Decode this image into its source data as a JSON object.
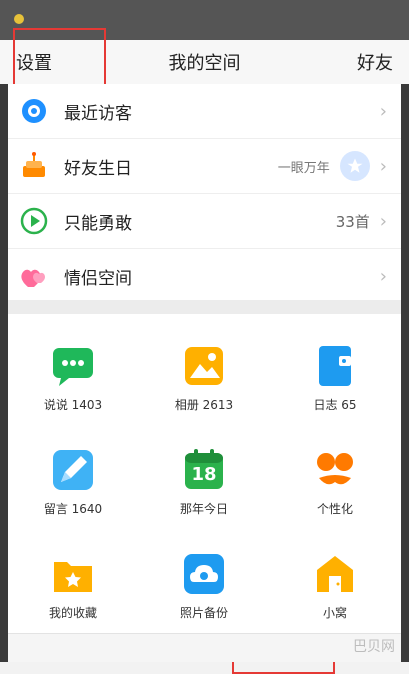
{
  "header": {
    "left": "设置",
    "title": "我的空间",
    "right": "好友"
  },
  "list": [
    {
      "label": "最近访客",
      "value": "",
      "icon": "eye-icon"
    },
    {
      "label": "好友生日",
      "value": "一眼万年",
      "icon": "cake-icon"
    },
    {
      "label": "只能勇敢",
      "value": "33首",
      "icon": "play-icon"
    },
    {
      "label": "情侣空间",
      "value": "",
      "icon": "hearts-icon"
    }
  ],
  "grid": [
    {
      "label": "说说 1403",
      "icon": "chat-bubble-icon"
    },
    {
      "label": "相册 2613",
      "icon": "photo-album-icon"
    },
    {
      "label": "日志 65",
      "icon": "journal-icon"
    },
    {
      "label": "留言 1640",
      "icon": "pen-icon"
    },
    {
      "label": "那年今日",
      "icon": "calendar-icon",
      "day": "18"
    },
    {
      "label": "个性化",
      "icon": "face-icon"
    },
    {
      "label": "我的收藏",
      "icon": "folder-star-icon"
    },
    {
      "label": "照片备份",
      "icon": "cloud-icon"
    },
    {
      "label": "小窝",
      "icon": "house-icon"
    }
  ],
  "watermark": "巴贝网",
  "colors": {
    "accent": "#1eaaf1",
    "red_box": "#e53935"
  }
}
